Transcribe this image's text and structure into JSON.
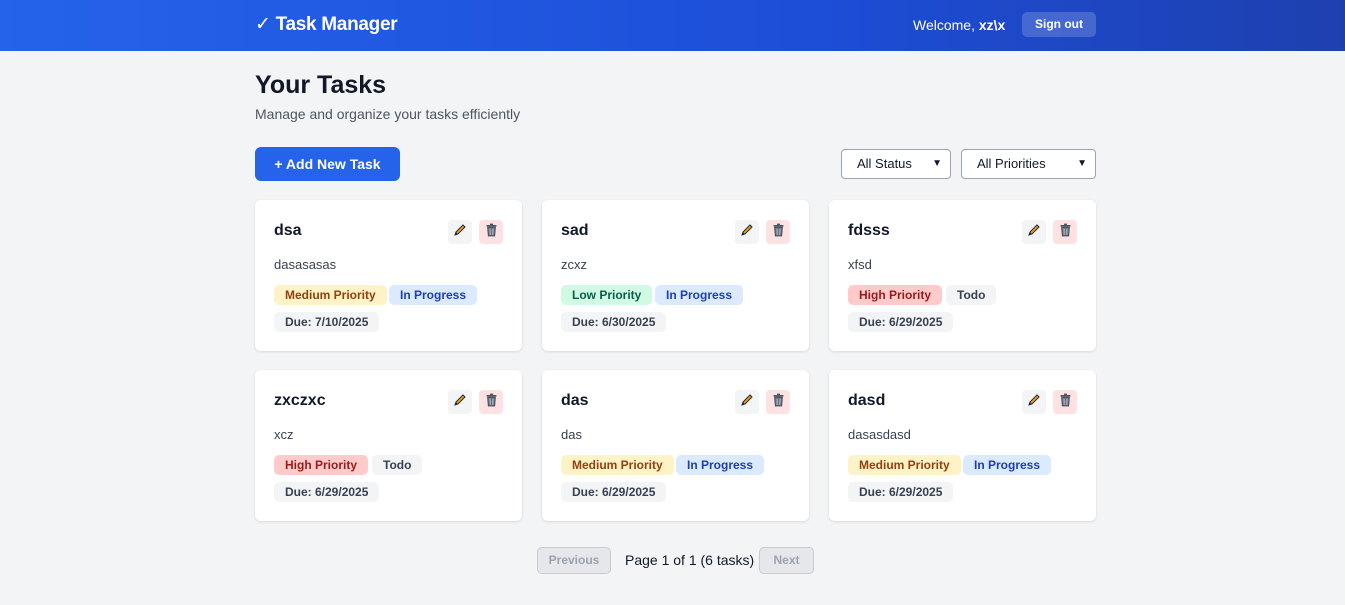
{
  "header": {
    "brand": "✓ Task Manager",
    "welcome_prefix": "Welcome, ",
    "username": "xz\\x",
    "signout_label": "Sign out"
  },
  "main": {
    "title": "Your Tasks",
    "subtitle": "Manage and organize your tasks efficiently",
    "add_button_label": "+ Add New Task",
    "status_filter": {
      "selected": "All Status"
    },
    "priority_filter": {
      "selected": "All Priorities"
    }
  },
  "colors": {
    "priority_medium_bg": "#fef3c7",
    "priority_medium_fg": "#92400e",
    "priority_low_bg": "#d1fae5",
    "priority_low_fg": "#065f46",
    "priority_high_bg": "#fecaca",
    "priority_high_fg": "#991b1b",
    "status_inprogress_bg": "#dbeafe",
    "status_inprogress_fg": "#1e40af",
    "status_todo_bg": "#f3f4f6",
    "status_todo_fg": "#374151",
    "due_bg": "#f3f4f6",
    "due_fg": "#374151"
  },
  "tasks": [
    {
      "title": "dsa",
      "description": "dasasasas",
      "priority": "Medium Priority",
      "status": "In Progress",
      "due": "Due: 7/10/2025"
    },
    {
      "title": "sad",
      "description": "zcxz",
      "priority": "Low Priority",
      "status": "In Progress",
      "due": "Due: 6/30/2025"
    },
    {
      "title": "fdsss",
      "description": "xfsd",
      "priority": "High Priority",
      "status": "Todo",
      "due": "Due: 6/29/2025"
    },
    {
      "title": "zxczxc",
      "description": "xcz",
      "priority": "High Priority",
      "status": "Todo",
      "due": "Due: 6/29/2025"
    },
    {
      "title": "das",
      "description": "das",
      "priority": "Medium Priority",
      "status": "In Progress",
      "due": "Due: 6/29/2025"
    },
    {
      "title": "dasd",
      "description": "dasasdasd",
      "priority": "Medium Priority",
      "status": "In Progress",
      "due": "Due: 6/29/2025"
    }
  ],
  "pagination": {
    "previous_label": "Previous",
    "page_text": "Page 1 of 1 (6 tasks)",
    "next_label": "Next"
  }
}
